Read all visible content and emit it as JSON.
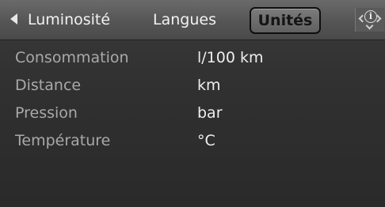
{
  "tabs": {
    "luminosite": "Luminosité",
    "langues": "Langues",
    "unites": "Unités",
    "active": "Unités"
  },
  "icons": {
    "left_arrow": "left-arrow-icon",
    "info": "info-icon"
  },
  "info_letter": "i",
  "rows": [
    {
      "label": "Consommation",
      "value": "l/100 km"
    },
    {
      "label": "Distance",
      "value": "km"
    },
    {
      "label": "Pression",
      "value": "bar"
    },
    {
      "label": "Température",
      "value": "°C"
    }
  ],
  "colors": {
    "background": "#2e2e2e",
    "tab_bar": "#555555",
    "active_tab": "#6a6a6a",
    "label_text": "#a9a9a9",
    "value_text": "#eeeeee"
  }
}
